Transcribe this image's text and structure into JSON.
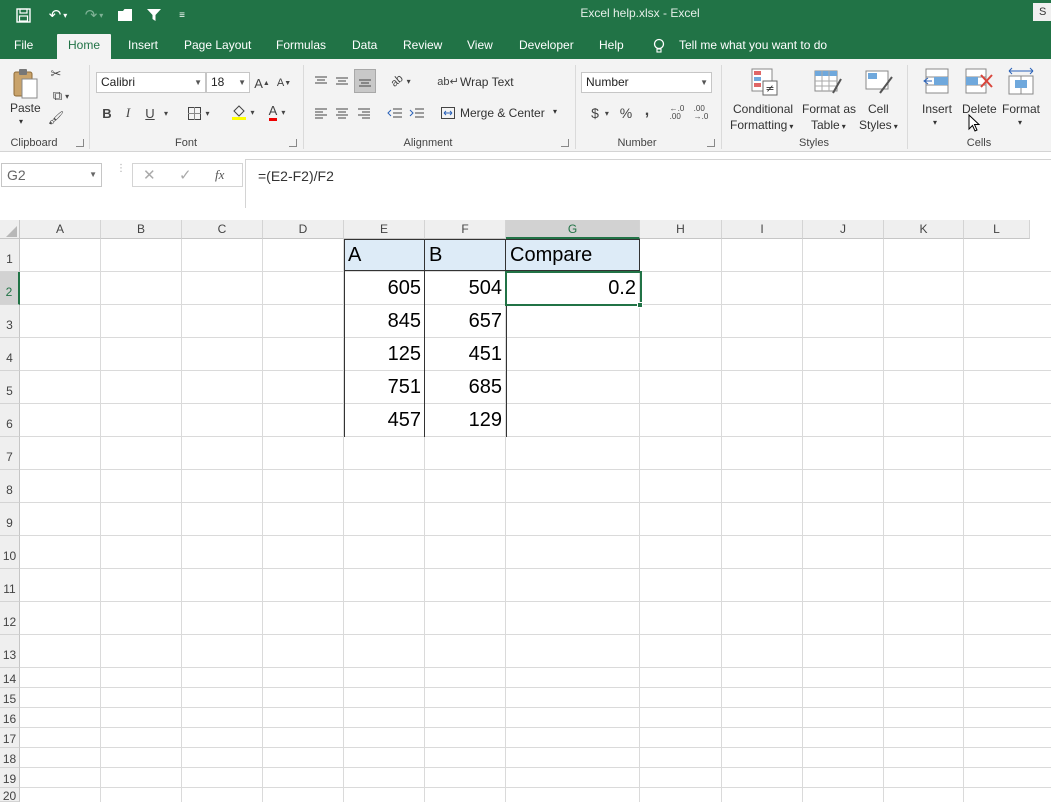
{
  "window": {
    "title": "Excel help.xlsx  -  Excel",
    "user_badge": "S"
  },
  "tabs": [
    "File",
    "Home",
    "Insert",
    "Page Layout",
    "Formulas",
    "Data",
    "Review",
    "View",
    "Developer",
    "Help"
  ],
  "tell_me": "Tell me what you want to do",
  "ribbon": {
    "clipboard": {
      "label": "Clipboard",
      "paste": "Paste"
    },
    "font": {
      "label": "Font",
      "font_name": "Calibri",
      "font_size": "18",
      "bold": "B",
      "italic": "I",
      "underline": "U"
    },
    "alignment": {
      "label": "Alignment",
      "wrap_text": "Wrap Text",
      "merge_center": "Merge & Center"
    },
    "number": {
      "label": "Number",
      "format": "Number",
      "currency": "$",
      "percent": "%",
      "comma": ","
    },
    "styles": {
      "label": "Styles",
      "conditional_1": "Conditional",
      "conditional_2": "Formatting",
      "format_table_1": "Format as",
      "format_table_2": "Table",
      "cell_styles_1": "Cell",
      "cell_styles_2": "Styles"
    },
    "cells": {
      "label": "Cells",
      "insert": "Insert",
      "delete": "Delete",
      "format": "Format"
    }
  },
  "formula_bar": {
    "name_box": "G2",
    "formula": "=(E2-F2)/F2"
  },
  "columns": [
    "A",
    "B",
    "C",
    "D",
    "E",
    "F",
    "G",
    "H",
    "I",
    "J",
    "K",
    "L"
  ],
  "rows": [
    "1",
    "2",
    "3",
    "4",
    "5",
    "6",
    "7",
    "8",
    "9",
    "10",
    "11",
    "12",
    "13",
    "14",
    "15",
    "16",
    "17",
    "18",
    "19",
    "20"
  ],
  "sheet": {
    "headers": {
      "E1": "A",
      "F1": "B",
      "G1": "Compare"
    },
    "E": [
      "605",
      "845",
      "125",
      "751",
      "457"
    ],
    "F": [
      "504",
      "657",
      "451",
      "685",
      "129"
    ],
    "G2": "0.2"
  },
  "colors": {
    "accent": "#217346",
    "header_fill": "#ddebf7"
  }
}
